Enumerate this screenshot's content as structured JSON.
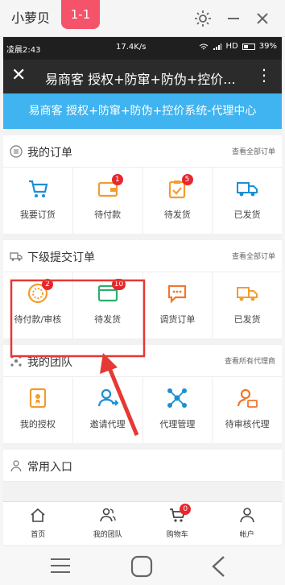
{
  "frame": {
    "app_name": "小萝贝",
    "page_indicator": "1-1"
  },
  "status": {
    "time": "凌晨2:43",
    "network_speed": "17.4K/s",
    "battery": "39%",
    "network_type": "HD"
  },
  "titlebar": {
    "title": "易商客 授权+防窜+防伪+控价..."
  },
  "banner": {
    "text": "易商客 授权+防窜+防伪+控价系统-代理中心"
  },
  "orders": {
    "title": "我的订单",
    "link": "查看全部订单",
    "items": [
      {
        "label": "我要订货",
        "icon": "shopping-cart-icon"
      },
      {
        "label": "待付款",
        "icon": "wallet-icon",
        "badge": "1"
      },
      {
        "label": "待发货",
        "icon": "clipboard-check-icon",
        "badge": "5"
      },
      {
        "label": "已发货",
        "icon": "truck-icon"
      }
    ]
  },
  "sub_orders": {
    "title": "下级提交订单",
    "link": "查看全部订单",
    "items": [
      {
        "label": "待付款/审核",
        "icon": "coins-icon",
        "badge": "2"
      },
      {
        "label": "待发货",
        "icon": "wallet-icon",
        "badge": "10"
      },
      {
        "label": "调货订单",
        "icon": "chat-icon"
      },
      {
        "label": "已发货",
        "icon": "truck-icon"
      }
    ]
  },
  "team": {
    "title": "我的团队",
    "link": "查看所有代理商",
    "items": [
      {
        "label": "我的授权",
        "icon": "certificate-icon"
      },
      {
        "label": "邀请代理",
        "icon": "invite-user-icon"
      },
      {
        "label": "代理管理",
        "icon": "network-icon"
      },
      {
        "label": "待审核代理",
        "icon": "pending-user-icon"
      }
    ]
  },
  "common": {
    "title": "常用入口"
  },
  "bottom_nav": [
    {
      "label": "首页",
      "icon": "home-icon"
    },
    {
      "label": "我的团队",
      "icon": "team-icon"
    },
    {
      "label": "购物车",
      "icon": "cart-icon",
      "badge": "0"
    },
    {
      "label": "帐户",
      "icon": "account-icon"
    }
  ],
  "colors": {
    "accent_blue": "#3fb4f0",
    "icon_orange": "#f39c2f",
    "badge_red": "#e8272d",
    "annotation_red": "#e53935"
  }
}
